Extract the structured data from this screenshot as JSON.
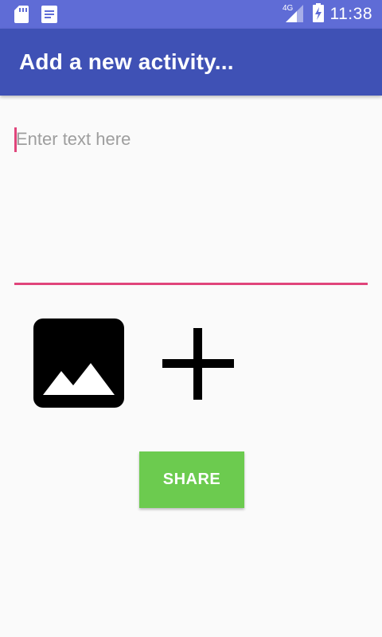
{
  "status_bar": {
    "time": "11:38",
    "network": "4G",
    "icons": [
      "sd-card-icon",
      "notes-icon",
      "signal-icon",
      "battery-charging-icon"
    ]
  },
  "app_bar": {
    "title": "Add a new activity..."
  },
  "form": {
    "text_placeholder": "Enter text here",
    "text_value": "",
    "image_button_icon": "image-icon",
    "add_button_icon": "plus-icon",
    "share_label": "SHARE"
  },
  "colors": {
    "primary": "#3f51b5",
    "status_bar": "#5f6cd6",
    "accent": "#e0457b",
    "share_button": "#6ccb4f"
  }
}
